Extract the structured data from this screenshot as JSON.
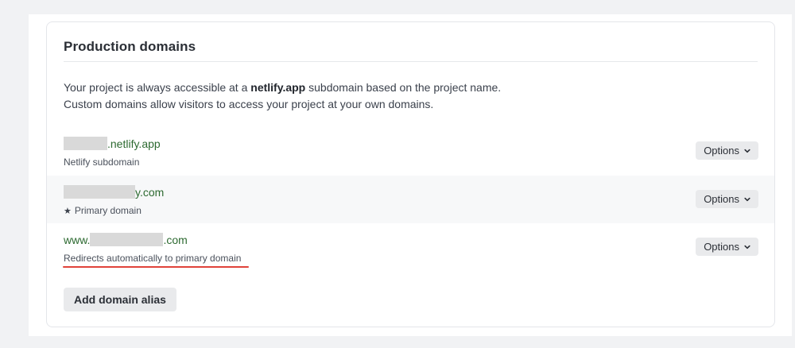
{
  "section": {
    "title": "Production domains",
    "intro_line1_prefix": "Your project is always accessible at a ",
    "intro_line1_bold": "netlify.app",
    "intro_line1_suffix": " subdomain based on the project name.",
    "intro_line2": "Custom domains allow visitors to access your project at your own domains."
  },
  "domains": [
    {
      "prefix": "",
      "suffix": ".netlify.app",
      "subtitle": "Netlify subdomain",
      "options_label": "Options"
    },
    {
      "prefix": "",
      "suffix": "y.com",
      "subtitle": "Primary domain",
      "subtitle_icon": "star-icon",
      "options_label": "Options"
    },
    {
      "prefix": "www.",
      "suffix": ".com",
      "subtitle": "Redirects automatically to primary domain",
      "options_label": "Options"
    }
  ],
  "actions": {
    "add_alias_label": "Add domain alias"
  },
  "colors": {
    "domain_text": "#2d6a31",
    "annotation_underline": "#e0433a",
    "button_bg": "#e9eaec"
  }
}
